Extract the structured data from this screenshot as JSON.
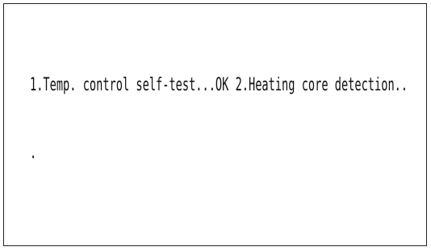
{
  "screen": {
    "line1": "1.Temp. control self-test...OK 2.Heating core detection..",
    "line2": "."
  },
  "colors": {
    "background": "#ffffff",
    "border": "#222222",
    "text": "#111111"
  }
}
